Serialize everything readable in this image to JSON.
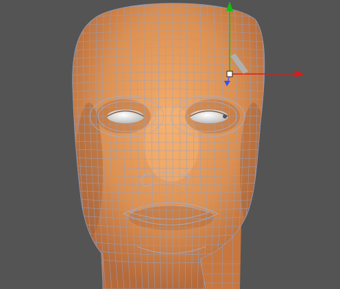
{
  "viewport": {
    "background": "#545454",
    "view_name": "perspective",
    "object": "head-mesh"
  },
  "colors": {
    "skin": "#d98c52",
    "skin_light": "#f2a867",
    "skin_shadow": "#a8643a",
    "wire": "#8fa3c8",
    "eye": "#dcdcdc",
    "axis_x": "#e01818",
    "axis_y": "#10c010",
    "axis_z": "#3050ff"
  },
  "gizmo": {
    "type": "move",
    "axes": [
      "x",
      "y",
      "z"
    ]
  }
}
